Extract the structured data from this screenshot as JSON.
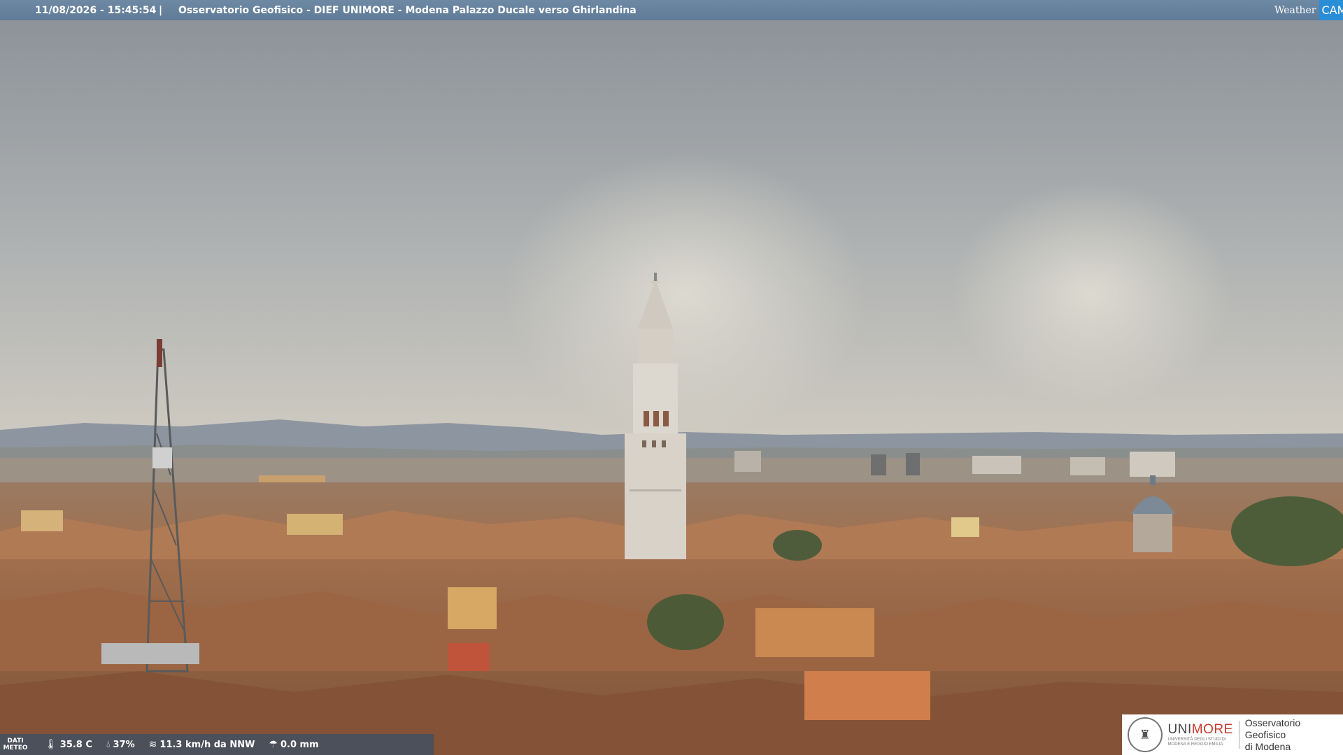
{
  "header": {
    "timestamp": "11/08/2026 - 15:45:54",
    "separator": "|",
    "title": "Osservatorio Geofisico - DIEF UNIMORE - Modena Palazzo Ducale verso Ghirlandina",
    "logo_weather": "Weather",
    "logo_cam": "CAM"
  },
  "weather": {
    "label_line1": "DATI",
    "label_line2": "METEO",
    "temperature": "35.8 C",
    "humidity": "37%",
    "wind": "11.3 km/h da NNW",
    "rain": "0.0 mm"
  },
  "footer_logo": {
    "university": "UNI",
    "university_accent": "MORE",
    "university_sub1": "UNIVERSITÀ DEGLI STUDI DI",
    "university_sub2": "MODENA E REGGIO EMILIA",
    "observatory_line1": "Osservatorio Geofisico",
    "observatory_line2": "di Modena"
  },
  "colors": {
    "sky_top": "#8f959c",
    "sky_bottom": "#c9c7c0",
    "roofs": "#a8724f",
    "tower": "#d9d4cb",
    "accent_more": "#c9392e",
    "cam_blue": "#2a8ed6"
  }
}
